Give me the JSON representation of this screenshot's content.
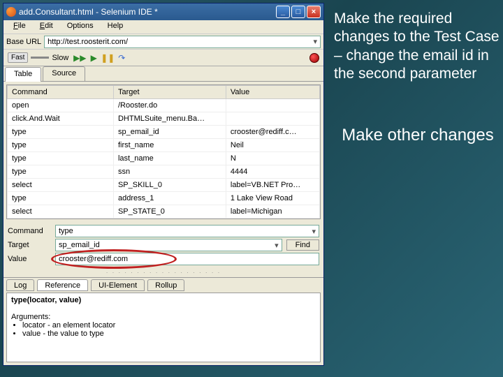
{
  "window": {
    "title": "add.Consultant.html - Selenium IDE *"
  },
  "menu": {
    "file": "File",
    "edit": "Edit",
    "options": "Options",
    "help": "Help"
  },
  "baseurl": {
    "label": "Base URL",
    "value": "http://test.roosterit.com/"
  },
  "speed": {
    "fast": "Fast",
    "slow": "Slow"
  },
  "tabs": {
    "table": "Table",
    "source": "Source"
  },
  "grid": {
    "headers": {
      "command": "Command",
      "target": "Target",
      "value": "Value"
    },
    "rows": [
      {
        "c": "open",
        "t": "/Rooster.do",
        "v": ""
      },
      {
        "c": "click.And.Wait",
        "t": "DHTMLSuite_menu.Ba…",
        "v": ""
      },
      {
        "c": "type",
        "t": "sp_email_id",
        "v": "crooster@rediff.c…"
      },
      {
        "c": "type",
        "t": "first_name",
        "v": "Neil"
      },
      {
        "c": "type",
        "t": "last_name",
        "v": "N"
      },
      {
        "c": "type",
        "t": "ssn",
        "v": "4444"
      },
      {
        "c": "select",
        "t": "SP_SKILL_0",
        "v": "label=VB.NET Pro…"
      },
      {
        "c": "type",
        "t": "address_1",
        "v": "1 Lake View Road"
      },
      {
        "c": "select",
        "t": "SP_STATE_0",
        "v": "label=Michigan"
      }
    ]
  },
  "fields": {
    "command_label": "Command",
    "command_value": "type",
    "target_label": "Target",
    "target_value": "sp_email_id",
    "find": "Find",
    "value_label": "Value",
    "value_value": "crooster@rediff.com"
  },
  "bottabs": {
    "log": "Log",
    "reference": "Reference",
    "uielement": "UI-Element",
    "rollup": "Rollup"
  },
  "reference": {
    "signature": "type(locator, value)",
    "args_label": "Arguments:",
    "arg1": "locator - an element locator",
    "arg2": "value - the value to type"
  },
  "annotation": {
    "p1": "Make the required changes to the Test Case – change the email id in the second parameter",
    "p2": "Make other changes"
  }
}
